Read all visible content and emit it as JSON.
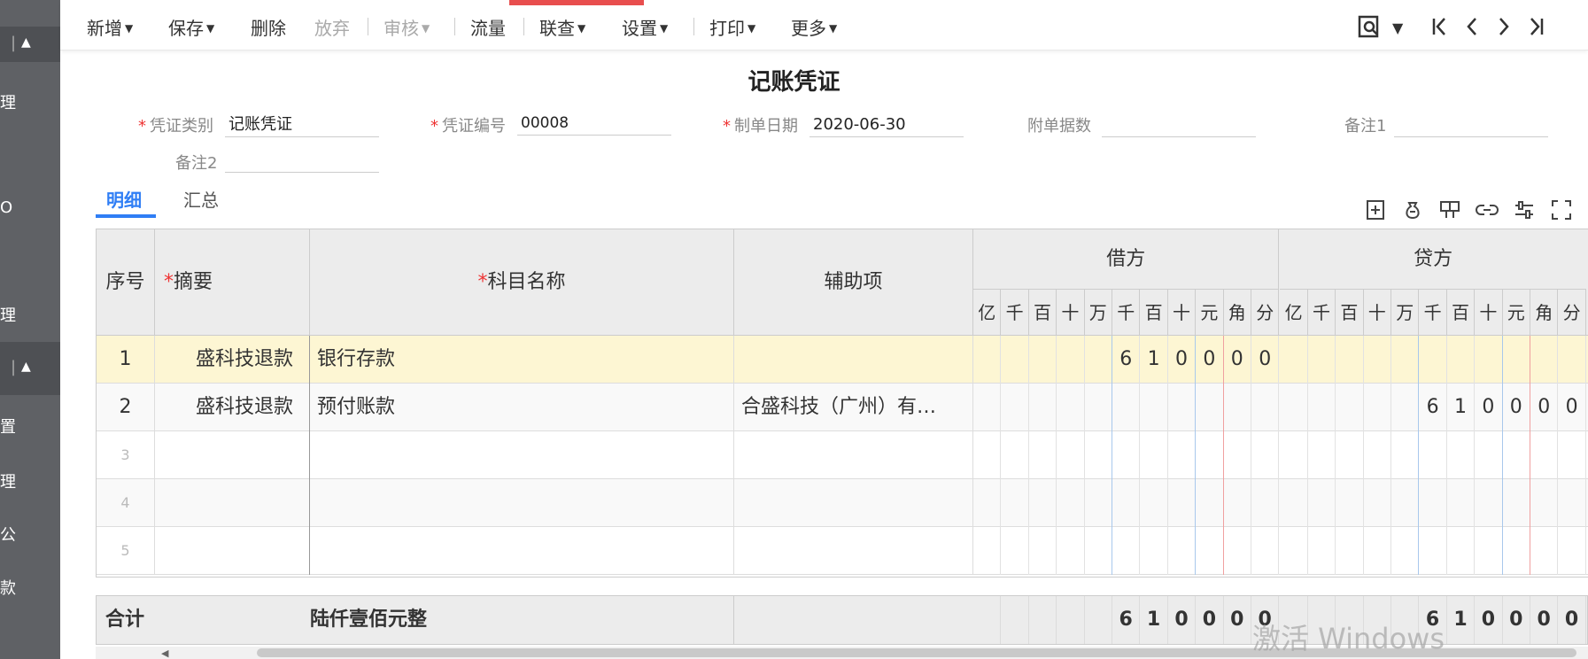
{
  "sidebar": {
    "items": [
      "理",
      "O",
      "理",
      "置",
      "理",
      "公",
      "款"
    ]
  },
  "toolbar": {
    "add": "新增",
    "save": "保存",
    "delete": "删除",
    "abandon": "放弃",
    "audit": "审核",
    "flow": "流量",
    "linked": "联查",
    "settings": "设置",
    "print": "打印",
    "more": "更多"
  },
  "voucher": {
    "title": "记账凭证",
    "type_label": "凭证类别",
    "type_value": "记账凭证",
    "number_label": "凭证编号",
    "number_value": "00008",
    "date_label": "制单日期",
    "date_value": "2020-06-30",
    "attachments_label": "附单据数",
    "attachments_value": "",
    "remark1_label": "备注1",
    "remark1_value": "",
    "remark2_label": "备注2",
    "remark2_value": ""
  },
  "tabs": {
    "detail": "明细",
    "summary": "汇总"
  },
  "grid": {
    "headers": {
      "index": "序号",
      "summary": "摘要",
      "account": "科目名称",
      "auxiliary": "辅助项",
      "debit": "借方",
      "credit": "贷方"
    },
    "digit_units": [
      "亿",
      "千",
      "百",
      "十",
      "万",
      "千",
      "百",
      "十",
      "元",
      "角",
      "分"
    ],
    "rows": [
      {
        "index": "1",
        "summary": "盛科技退款",
        "account": "银行存款",
        "auxiliary": "",
        "debit_digits": [
          "",
          "",
          "",
          "",
          "",
          "6",
          "1",
          "0",
          "0",
          "0",
          "0"
        ],
        "credit_digits": [
          "",
          "",
          "",
          "",
          "",
          "",
          "",
          "",
          "",
          "",
          ""
        ]
      },
      {
        "index": "2",
        "summary": "盛科技退款",
        "account": "预付账款",
        "auxiliary": "合盛科技（广州）有…",
        "debit_digits": [
          "",
          "",
          "",
          "",
          "",
          "",
          "",
          "",
          "",
          "",
          ""
        ],
        "credit_digits": [
          "",
          "",
          "",
          "",
          "",
          "6",
          "1",
          "0",
          "0",
          "0",
          "0"
        ]
      },
      {
        "index": "3",
        "summary": "",
        "account": "",
        "auxiliary": "",
        "debit_digits": [
          "",
          "",
          "",
          "",
          "",
          "",
          "",
          "",
          "",
          "",
          ""
        ],
        "credit_digits": [
          "",
          "",
          "",
          "",
          "",
          "",
          "",
          "",
          "",
          "",
          ""
        ]
      },
      {
        "index": "4",
        "summary": "",
        "account": "",
        "auxiliary": "",
        "debit_digits": [
          "",
          "",
          "",
          "",
          "",
          "",
          "",
          "",
          "",
          "",
          ""
        ],
        "credit_digits": [
          "",
          "",
          "",
          "",
          "",
          "",
          "",
          "",
          "",
          "",
          ""
        ]
      },
      {
        "index": "5",
        "summary": "",
        "account": "",
        "auxiliary": "",
        "debit_digits": [
          "",
          "",
          "",
          "",
          "",
          "",
          "",
          "",
          "",
          "",
          ""
        ],
        "credit_digits": [
          "",
          "",
          "",
          "",
          "",
          "",
          "",
          "",
          "",
          "",
          ""
        ]
      }
    ],
    "total": {
      "label": "合计",
      "amount_words": "陆仟壹佰元整",
      "debit_digits": [
        "",
        "",
        "",
        "",
        "",
        "6",
        "1",
        "0",
        "0",
        "0",
        "0"
      ],
      "credit_digits": [
        "",
        "",
        "",
        "",
        "",
        "6",
        "1",
        "0",
        "0",
        "0",
        "0"
      ]
    }
  },
  "watermark": "激活 Windows",
  "colors": {
    "accent": "#2f7ef5",
    "highlight_row": "#fdf6d3",
    "required": "#e33333",
    "sidebar": "#5f6165"
  }
}
